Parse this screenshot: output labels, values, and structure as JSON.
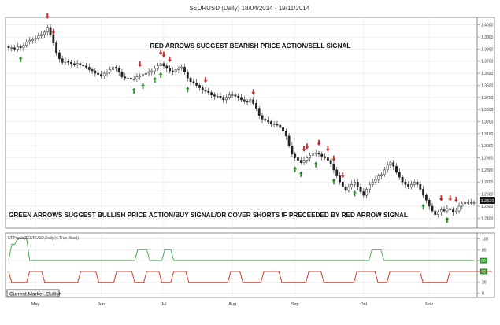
{
  "chart_data": [
    {
      "type": "candlestick",
      "title": "$EURUSD (Daily) 18/04/2014 - 19/11/2014",
      "y_ticks": [
        1.24,
        1.25,
        1.26,
        1.27,
        1.28,
        1.29,
        1.3,
        1.31,
        1.32,
        1.33,
        1.34,
        1.35,
        1.36,
        1.37,
        1.38,
        1.39,
        1.4
      ],
      "y_tick_labels": [
        "1.2400",
        "1.2500",
        "1.2600",
        "1.2700",
        "1.2800",
        "1.2900",
        "1.3000",
        "1.3100",
        "1.3200",
        "1.3300",
        "1.3400",
        "1.3500",
        "1.3600",
        "1.3700",
        "1.3800",
        "1.3900",
        "1.4000"
      ],
      "ylim": [
        1.233,
        1.405
      ],
      "last_price_label": "1.2530",
      "x_tick_labels": [
        "May",
        "Jun",
        "Jul",
        "Aug",
        "Sep",
        "Oct",
        "Nov"
      ],
      "x_tick_index": [
        9,
        31,
        52,
        75,
        96,
        119,
        141
      ],
      "bars_count": 155,
      "closes": [
        1.381,
        1.381,
        1.38,
        1.382,
        1.381,
        1.383,
        1.386,
        1.387,
        1.388,
        1.389,
        1.391,
        1.392,
        1.394,
        1.398,
        1.392,
        1.385,
        1.377,
        1.372,
        1.369,
        1.37,
        1.369,
        1.368,
        1.367,
        1.368,
        1.367,
        1.366,
        1.365,
        1.363,
        1.362,
        1.36,
        1.359,
        1.358,
        1.36,
        1.361,
        1.363,
        1.365,
        1.364,
        1.361,
        1.357,
        1.356,
        1.356,
        1.355,
        1.355,
        1.357,
        1.358,
        1.359,
        1.36,
        1.361,
        1.362,
        1.364,
        1.366,
        1.368,
        1.366,
        1.364,
        1.362,
        1.361,
        1.363,
        1.364,
        1.365,
        1.361,
        1.356,
        1.353,
        1.352,
        1.35,
        1.348,
        1.346,
        1.345,
        1.344,
        1.342,
        1.341,
        1.341,
        1.34,
        1.338,
        1.34,
        1.342,
        1.342,
        1.341,
        1.34,
        1.338,
        1.337,
        1.336,
        1.338,
        1.335,
        1.331,
        1.325,
        1.322,
        1.321,
        1.32,
        1.318,
        1.318,
        1.317,
        1.315,
        1.312,
        1.308,
        1.3,
        1.293,
        1.29,
        1.288,
        1.286,
        1.288,
        1.29,
        1.292,
        1.293,
        1.294,
        1.293,
        1.291,
        1.29,
        1.288,
        1.285,
        1.28,
        1.275,
        1.27,
        1.266,
        1.263,
        1.266,
        1.268,
        1.27,
        1.266,
        1.262,
        1.259,
        1.264,
        1.268,
        1.27,
        1.272,
        1.275,
        1.276,
        1.28,
        1.284,
        1.286,
        1.283,
        1.278,
        1.274,
        1.27,
        1.268,
        1.266,
        1.268,
        1.27,
        1.268,
        1.264,
        1.259,
        1.255,
        1.25,
        1.246,
        1.243,
        1.245,
        1.247,
        1.246,
        1.248,
        1.247,
        1.245,
        1.246,
        1.25,
        1.252,
        1.253,
        1.253,
        1.253,
        1.253
      ],
      "annotations": [
        "RED ARROWS SUGGEST BEARISH PRICE ACTION/SELL SIGNAL",
        "GREEN ARROWS SUGGEST BULLISH PRICE ACTION/BUY SIGNAL/OR COVER SHORTS IF PRECEEDED BY RED ARROW SIGNAL"
      ],
      "red_arrow_bars": [
        13,
        15,
        44,
        51,
        52,
        54,
        66,
        82,
        99,
        100,
        104,
        107,
        109,
        112,
        145,
        148,
        150
      ],
      "green_arrow_bars": [
        4,
        42,
        45,
        49,
        51,
        60,
        96,
        98,
        103,
        109,
        116,
        139,
        147
      ]
    },
    {
      "type": "line",
      "label": "UFPsych($EURUSD,Daily,(4,True,Bias))",
      "badge": "Current.Market..Bullish",
      "y_ticks": [
        0,
        20,
        40,
        60,
        80,
        100
      ],
      "ylim": [
        -5,
        108
      ],
      "right_badges": [
        {
          "value": 60,
          "color": "#2e9a2e"
        },
        {
          "value": 40,
          "color": "#2e9a2e"
        }
      ],
      "series": [
        {
          "color": "#4caf50",
          "values": [
            60,
            90,
            90,
            100,
            100,
            100,
            100,
            60,
            60,
            60,
            60,
            60,
            60,
            60,
            60,
            60,
            60,
            60,
            60,
            60,
            60,
            60,
            60,
            60,
            60,
            60,
            60,
            60,
            60,
            60,
            60,
            60,
            60,
            60,
            60,
            60,
            60,
            60,
            60,
            60,
            60,
            60,
            60,
            80,
            80,
            80,
            80,
            60,
            60,
            60,
            60,
            60,
            80,
            80,
            80,
            60,
            60,
            60,
            60,
            60,
            60,
            60,
            60,
            60,
            60,
            60,
            60,
            60,
            60,
            60,
            60,
            60,
            60,
            60,
            60,
            60,
            60,
            60,
            60,
            60,
            60,
            60,
            60,
            60,
            60,
            60,
            60,
            60,
            60,
            60,
            60,
            60,
            60,
            60,
            60,
            60,
            60,
            60,
            60,
            60,
            60,
            60,
            60,
            60,
            60,
            60,
            60,
            60,
            60,
            60,
            60,
            60,
            60,
            60,
            60,
            60,
            60,
            60,
            60,
            60,
            60,
            80,
            80,
            80,
            80,
            60,
            60,
            60,
            60,
            60,
            60,
            60,
            60,
            60,
            60,
            60,
            60,
            60,
            60,
            60,
            60,
            60,
            60,
            60,
            60,
            60,
            60,
            60,
            60,
            60,
            60,
            60,
            60,
            60,
            60,
            60
          ]
        },
        {
          "color": "#d33b2c",
          "values": [
            40,
            20,
            20,
            20,
            20,
            20,
            20,
            40,
            40,
            40,
            40,
            40,
            20,
            20,
            20,
            20,
            20,
            20,
            20,
            20,
            20,
            20,
            20,
            20,
            40,
            40,
            40,
            40,
            40,
            40,
            20,
            20,
            20,
            20,
            20,
            20,
            40,
            40,
            40,
            40,
            40,
            40,
            20,
            20,
            20,
            20,
            40,
            40,
            40,
            40,
            40,
            20,
            20,
            20,
            20,
            40,
            40,
            40,
            40,
            40,
            20,
            20,
            20,
            20,
            20,
            20,
            20,
            20,
            20,
            20,
            20,
            20,
            20,
            20,
            40,
            40,
            40,
            40,
            20,
            20,
            20,
            20,
            20,
            20,
            20,
            40,
            40,
            40,
            40,
            40,
            40,
            20,
            20,
            20,
            20,
            20,
            20,
            20,
            20,
            20,
            40,
            40,
            40,
            40,
            40,
            20,
            20,
            20,
            20,
            20,
            20,
            20,
            20,
            20,
            20,
            20,
            40,
            40,
            40,
            40,
            40,
            40,
            40,
            20,
            20,
            20,
            20,
            40,
            40,
            40,
            40,
            40,
            40,
            40,
            40,
            40,
            40,
            40,
            20,
            20,
            20,
            20,
            20,
            20,
            20,
            20,
            20,
            40,
            40,
            40,
            40,
            40,
            40,
            40,
            40,
            40,
            40,
            40,
            40,
            40,
            40,
            40
          ]
        }
      ]
    }
  ]
}
